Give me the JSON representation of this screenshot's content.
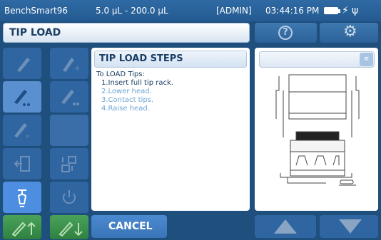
{
  "status": {
    "device": "BenchSmart96",
    "volume_range": "5.0 µL - 200.0 µL",
    "user": "[ADMIN]",
    "time": "03:44:16 PM"
  },
  "header": {
    "title": "TIP LOAD",
    "help_glyph": "?",
    "gear_glyph": "⚙"
  },
  "steps": {
    "title": "TIP LOAD STEPS",
    "intro": "To LOAD Tips:",
    "items": [
      "1.Insert full tip rack.",
      "2.Lower head.",
      "3.Contact tips.",
      "4.Raise head."
    ],
    "current_step_index": 0
  },
  "bottom": {
    "cancel_label": "CANCEL"
  },
  "icons": {
    "tools": [
      "pipette-icon",
      "pipette-plus-icon",
      "pipette-mix-icon",
      "pipette-dispense-icon",
      "pipette-back-icon",
      "door-exit-icon",
      "transfer-layout-icon",
      "tip-load-icon",
      "power-icon"
    ],
    "bottom": [
      "pipette-up-icon",
      "pipette-down-icon",
      "up-arrow-icon",
      "down-arrow-icon"
    ]
  },
  "colors": {
    "background": "#1e4f7d",
    "accent": "#4d8ee0",
    "green": "#3a9a4a",
    "step_done": "#1c3f66",
    "step_pending": "#6fa4d4"
  }
}
